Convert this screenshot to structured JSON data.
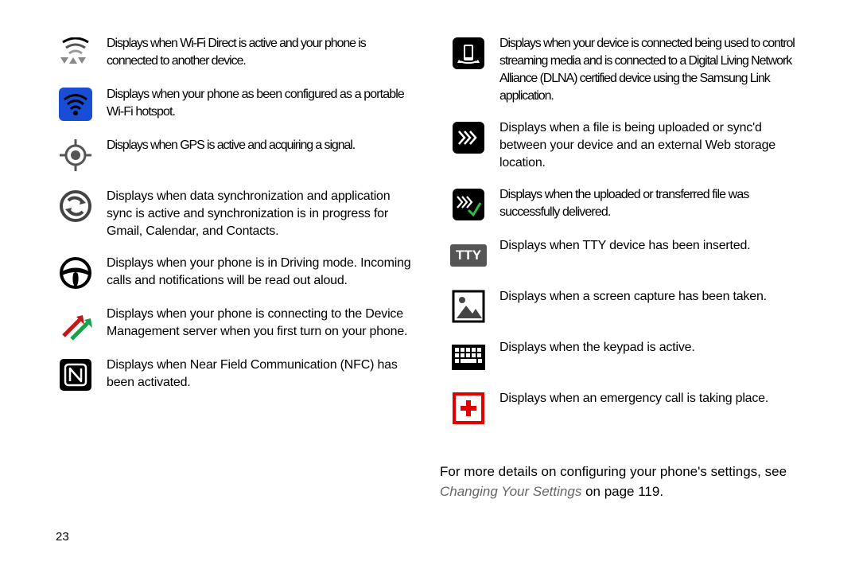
{
  "left": [
    {
      "id": "wifi-direct",
      "text": "Displays when Wi-Fi Direct is active and your phone is connected to another device.",
      "tight": true
    },
    {
      "id": "wifi-hotspot",
      "text": "Displays when your phone as been configured as a portable Wi-Fi hotspot.",
      "tight": true
    },
    {
      "id": "gps",
      "text": "Displays when GPS is active and acquiring a signal.",
      "tight": true
    },
    {
      "id": "sync",
      "text": "Displays when data synchronization and application sync is active and synchronization is in progress for Gmail, Calendar, and Contacts."
    },
    {
      "id": "driving",
      "text": "Displays when your phone is in Driving mode. Incoming calls and notifications will be read out aloud."
    },
    {
      "id": "dm-server",
      "text": "Displays when your phone is connecting to the Device Management server when you first turn on your phone."
    },
    {
      "id": "nfc",
      "text": "Displays when Near Field Communication (NFC) has been activated."
    }
  ],
  "right": [
    {
      "id": "dlna",
      "text": "Displays when your device is connected being used to control streaming media and is connected to a Digital Living Network Alliance (DLNA) certified device using the Samsung Link application.",
      "tight": true
    },
    {
      "id": "upload",
      "text": "Displays when a file is being uploaded or sync'd between your device and an external Web storage location."
    },
    {
      "id": "upload-done",
      "text": "Displays when the uploaded or transferred file was successfully delivered.",
      "tight": true
    },
    {
      "id": "tty",
      "text": "Displays when TTY device has been inserted."
    },
    {
      "id": "screenshot",
      "text": "Displays when a screen capture has been taken."
    },
    {
      "id": "keypad",
      "text": "Displays when the keypad is active."
    },
    {
      "id": "emergency",
      "text": "Displays when an emergency call is taking place."
    }
  ],
  "tty_label": "TTY",
  "footer_lead": "For more details on configuring your phone's settings, see ",
  "footer_link": "Changing Your Settings",
  "footer_tail": " on page 119.",
  "page_number": "23"
}
